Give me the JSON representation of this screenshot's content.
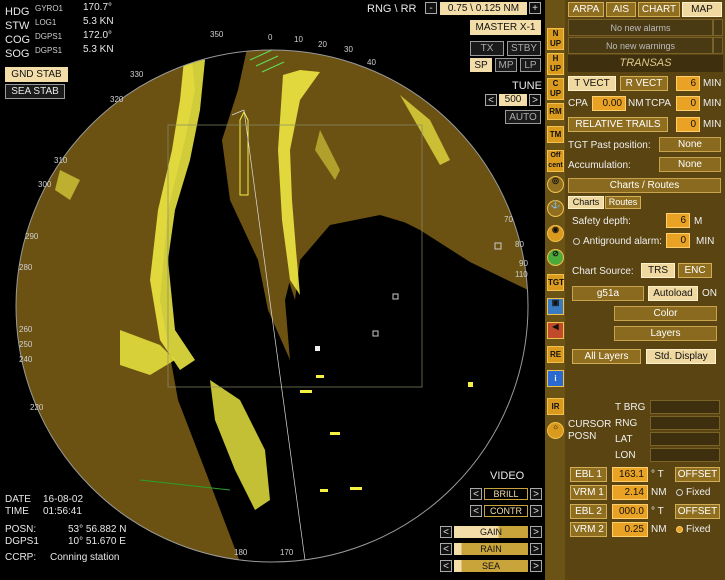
{
  "nav": {
    "hdg": {
      "label": "HDG",
      "src": "GYRO1",
      "value": "170.7°"
    },
    "stw": {
      "label": "STW",
      "src": "LOG1",
      "value": "5.3 KN"
    },
    "cog": {
      "label": "COG",
      "src": "DGPS1",
      "value": "172.0°"
    },
    "sog": {
      "label": "SOG",
      "src": "DGPS1",
      "value": "5.3 KN"
    }
  },
  "stab": {
    "gnd": "GND STAB",
    "sea": "SEA STAB"
  },
  "range": {
    "label": "RNG \\ RR",
    "minus": "-",
    "value": "0.75 \\ 0.125 NM",
    "plus": "+"
  },
  "radar": {
    "master": "MASTER X-1",
    "tx": "TX",
    "stby": "STBY",
    "sp": "SP",
    "mp": "MP",
    "lp": "LP",
    "tune_label": "TUNE",
    "tune_left": "<",
    "tune_value": "500",
    "tune_right": ">",
    "auto": "AUTO"
  },
  "video": {
    "label": "VIDEO",
    "brill": "BRILL",
    "contr": "CONTR",
    "gain": "GAIN",
    "rain": "RAIN",
    "sea": "SEA",
    "left": "<",
    "right": ">"
  },
  "bottom_info": {
    "date_label": "DATE",
    "date": "16-08-02",
    "time_label": "TIME",
    "time": "01:56:41",
    "posn_label": "POSN:",
    "lat": "53° 56.882 N",
    "dgps_label": "DGPS1",
    "lon": "10° 51.670 E",
    "ccrp_label": "CCRP:",
    "ccrp": "Conning station"
  },
  "bearing_ticks": {
    "t0": "0",
    "t10": "10",
    "t20": "20",
    "t30": "30",
    "t40": "40",
    "t70": "70",
    "t80": "80",
    "t90": "90",
    "t100": "100",
    "t110": "110",
    "t170": "170",
    "t180": "180",
    "t200": "200",
    "t220": "220",
    "t240": "240",
    "t250": "250",
    "t260": "260",
    "t270": "270",
    "t280": "280",
    "t290": "290",
    "t300": "300",
    "t310": "310",
    "t320": "320",
    "t330": "330",
    "t340": "340",
    "t350": "350"
  },
  "side_strip": {
    "n_up": "N UP",
    "h_up": "H UP",
    "c_up": "C UP",
    "rm": "RM",
    "tm": "TM",
    "off_cent": "Off cent",
    "tgt": "TGT",
    "re": "RE",
    "ir": "IR"
  },
  "top_tabs": [
    "ARPA",
    "AIS",
    "CHART",
    "MAP"
  ],
  "alarms": {
    "alarms": "No new alarms",
    "warnings": "No new warnings"
  },
  "logo": "TRANSAS",
  "vectors": {
    "t_vect": "T VECT",
    "r_vect": "R VECT",
    "vect_value": "6",
    "vect_unit": "MIN",
    "cpa_label": "CPA",
    "cpa_value": "0.00",
    "cpa_unit": "NM",
    "tcpa_label": "TCPA",
    "tcpa_value": "0",
    "tcpa_unit": "MIN",
    "trails": "RELATIVE TRAILS",
    "trails_value": "0",
    "trails_unit": "MIN",
    "tgt_past_label": "TGT Past position:",
    "tgt_past_value": "None",
    "accum_label": "Accumulation:",
    "accum_value": "None"
  },
  "charts": {
    "dropdown": "Charts / Routes",
    "tabs": [
      "Charts",
      "Routes"
    ],
    "safety_label": "Safety depth:",
    "safety_value": "6",
    "safety_unit": "M",
    "antiground_label": "Antiground alarm:",
    "antiground_value": "0",
    "antiground_unit": "MIN",
    "source_label": "Chart Source:",
    "src_trs": "TRS",
    "src_enc": "ENC",
    "chart_name": "g51a",
    "autoload": "Autoload",
    "autoload_state": "ON",
    "color": "Color",
    "layers": "Layers",
    "all_layers": "All Layers",
    "std_display": "Std. Display"
  },
  "cursor": {
    "title1": "CURSOR",
    "title2": "POSN",
    "t_brg": "T BRG",
    "rng": "RNG",
    "lat": "LAT",
    "lon": "LON"
  },
  "ebl_vrm": [
    {
      "label": "EBL 1",
      "value": "163.1",
      "unit": "° T",
      "extra": "OFFSET"
    },
    {
      "label": "VRM 1",
      "value": "2.14",
      "unit": "NM",
      "extra": "Fixed"
    },
    {
      "label": "EBL 2",
      "value": "000.0",
      "unit": "° T",
      "extra": "OFFSET"
    },
    {
      "label": "VRM 2",
      "value": "0.25",
      "unit": "NM",
      "extra": "Fixed"
    }
  ],
  "colors": {
    "land": "#6b5212",
    "echo": "#f4f044",
    "panel": "#5a4412",
    "accent": "#e9a224"
  }
}
